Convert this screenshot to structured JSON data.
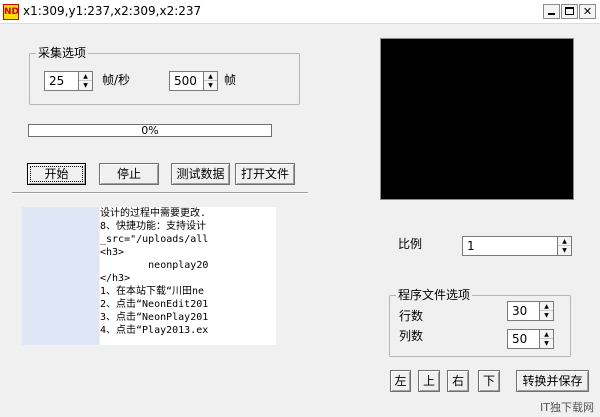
{
  "window": {
    "title": "x1:309,y1:237,x2:309,x2:237",
    "app_icon_text": "ND",
    "buttons": [
      "minimize",
      "maximize",
      "close"
    ]
  },
  "capture_options": {
    "legend": "采集选项",
    "fps_value": "25",
    "fps_unit": "帧/秒",
    "frames_value": "500",
    "frames_unit": "帧"
  },
  "progress": {
    "value": 0,
    "text": "0%"
  },
  "actions": {
    "start": "开始",
    "stop": "停止",
    "test_data": "测试数据",
    "open_file": "打开文件"
  },
  "text_lines": [
    "设计的过程中需要更改.",
    "8、快捷功能：支持设计",
    "_src=\"/uploads/all",
    "<h3>",
    "        neonplay20",
    "</h3>",
    "1、在本站下载“川田ne",
    "2、点击“NeonEdit201",
    "3、点击“NeonPlay201",
    "4、点击“Play2013.ex"
  ],
  "ratio": {
    "label": "比例",
    "value": "1"
  },
  "program_options": {
    "legend": "程序文件选项",
    "rows_label": "行数",
    "rows_value": "30",
    "cols_label": "列数",
    "cols_value": "50"
  },
  "nav": {
    "left": "左",
    "up": "上",
    "right": "右",
    "down": "下",
    "convert_save": "转换并保存"
  },
  "watermark": "IT独下载网",
  "colors": {
    "preview_bg": "#000000",
    "progress_fill": "#3c78d8",
    "thumb_panel": "#dfe6f5"
  }
}
